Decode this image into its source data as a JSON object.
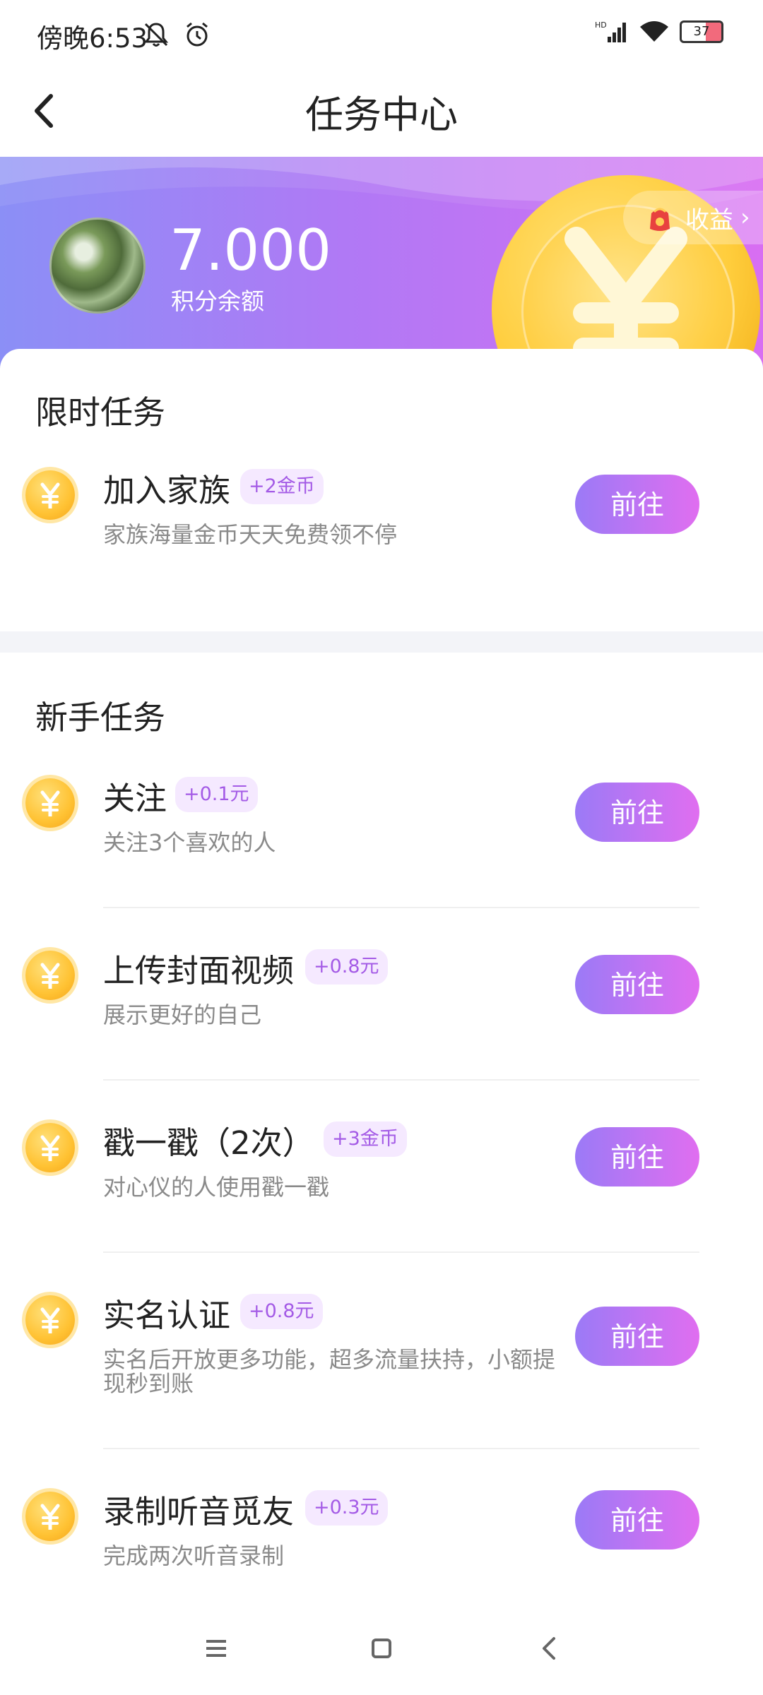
{
  "status_bar": {
    "time": "傍晚6:53",
    "battery": "37"
  },
  "nav": {
    "title": "任务中心"
  },
  "header": {
    "points_value": "7.000",
    "points_label": "积分余额",
    "earnings_label": "收益",
    "earnings_arrow": "›"
  },
  "limited_section": {
    "title": "限时任务",
    "tasks": [
      {
        "name": "加入家族",
        "badge": "+2金币",
        "desc": "家族海量金币天天免费领不停",
        "button": "前往"
      }
    ]
  },
  "newbie_section": {
    "title": "新手任务",
    "tasks": [
      {
        "name": "关注",
        "badge": "+0.1元",
        "desc": "关注3个喜欢的人",
        "button": "前往"
      },
      {
        "name": "上传封面视频",
        "badge": "+0.8元",
        "desc": "展示更好的自己",
        "button": "前往"
      },
      {
        "name": "戳一戳（2次）",
        "badge": "+3金币",
        "desc": "对心仪的人使用戳一戳",
        "button": "前往"
      },
      {
        "name": "实名认证",
        "badge": "+0.8元",
        "desc": "实名后开放更多功能，超多流量扶持，小额提现秒到账",
        "button": "前往"
      },
      {
        "name": "录制听音觅友",
        "badge": "+0.3元",
        "desc": "完成两次听音录制",
        "button": "前往"
      }
    ]
  },
  "colors": {
    "accent_start": "#9b7af6",
    "accent_end": "#e06ef0",
    "badge_bg": "#f5e9ff",
    "badge_text": "#a45be6",
    "coin": "#ffc233"
  },
  "icons": [
    "back-arrow-icon",
    "mute-icon",
    "alarm-icon",
    "signal-icon",
    "wifi-icon",
    "battery-icon",
    "red-envelope-icon",
    "coin-icon",
    "menu-icon",
    "home-icon",
    "nav-back-icon"
  ]
}
